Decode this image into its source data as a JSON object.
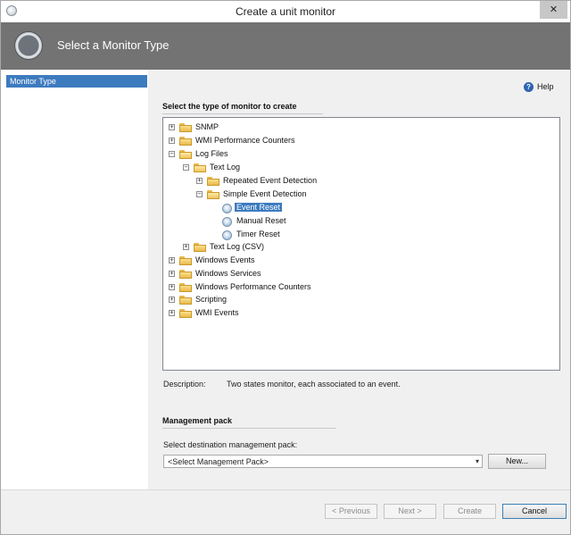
{
  "window": {
    "title": "Create a unit monitor",
    "close_glyph": "✕"
  },
  "header": {
    "title": "Select a Monitor Type"
  },
  "nav": {
    "items": [
      {
        "label": "Monitor Type",
        "selected": true
      }
    ]
  },
  "help": {
    "label": "Help",
    "icon_glyph": "?"
  },
  "monitor_section": {
    "title": "Select the type of monitor to create"
  },
  "tree": {
    "items": [
      {
        "label": "SNMP",
        "icon": "folder-icon",
        "expander": "+"
      },
      {
        "label": "WMI Performance Counters",
        "icon": "folder-icon",
        "expander": "+"
      },
      {
        "label": "Log Files",
        "icon": "folder-open-icon",
        "expander": "−"
      },
      {
        "label": "Text Log",
        "icon": "folder-open-icon",
        "expander": "−"
      },
      {
        "label": "Repeated Event Detection",
        "icon": "folder-icon",
        "expander": "+"
      },
      {
        "label": "Simple Event Detection",
        "icon": "folder-open-icon",
        "expander": "−"
      },
      {
        "label": "Event Reset",
        "icon": "monitor-node-icon",
        "selected": true
      },
      {
        "label": "Manual Reset",
        "icon": "monitor-node-icon"
      },
      {
        "label": "Timer Reset",
        "icon": "monitor-node-icon"
      },
      {
        "label": "Text Log (CSV)",
        "icon": "folder-icon",
        "expander": "+"
      },
      {
        "label": "Windows Events",
        "icon": "folder-icon",
        "expander": "+"
      },
      {
        "label": "Windows Services",
        "icon": "folder-icon",
        "expander": "+"
      },
      {
        "label": "Windows Performance Counters",
        "icon": "folder-icon",
        "expander": "+"
      },
      {
        "label": "Scripting",
        "icon": "folder-icon",
        "expander": "+"
      },
      {
        "label": "WMI Events",
        "icon": "folder-icon",
        "expander": "+"
      }
    ]
  },
  "description": {
    "label": "Description:",
    "value": "Two states monitor, each associated to an event."
  },
  "management_pack": {
    "title": "Management pack",
    "select_label": "Select destination management pack:",
    "selected_value": "<Select Management Pack>",
    "dropdown_glyph": "▾",
    "new_button": "New..."
  },
  "footer": {
    "previous": "< Previous",
    "next": "Next >",
    "create": "Create",
    "cancel": "Cancel"
  },
  "colors": {
    "selection": "#3d7bbf",
    "header": "#737373",
    "folder": "#f0c35d"
  }
}
